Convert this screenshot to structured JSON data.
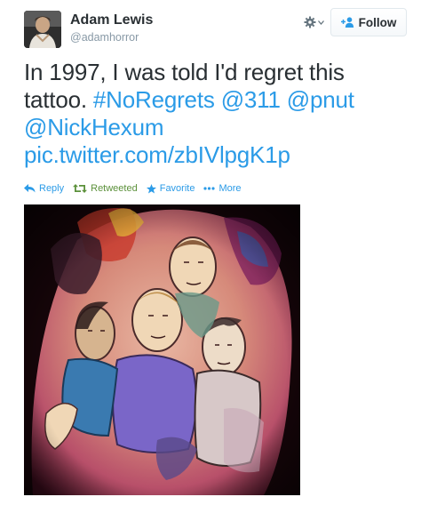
{
  "user": {
    "name": "Adam Lewis",
    "handle": "@adamhorror",
    "avatar_icon": "user-avatar"
  },
  "header": {
    "settings_icon": "gear-icon",
    "follow_label": "Follow",
    "follow_icon": "add-person-icon"
  },
  "tweet": {
    "text_line1": "In 1997, I was told I'd regret this",
    "text_line2_prefix": "tattoo. ",
    "hashtag": "#NoRegrets",
    "mention1": "@311",
    "mention2": "@pnut",
    "mention3": "@NickHexum",
    "link": "pic.twitter.com/zbIVlpgK1p"
  },
  "actions": {
    "reply": "Reply",
    "retweet": "Retweeted",
    "favorite": "Favorite",
    "more": "More"
  },
  "colors": {
    "link": "#2b9be7",
    "retweeted": "#5c913b",
    "text": "#292f33",
    "muted": "#8899a6"
  },
  "media": {
    "description_icon": "tattoo-photo"
  }
}
